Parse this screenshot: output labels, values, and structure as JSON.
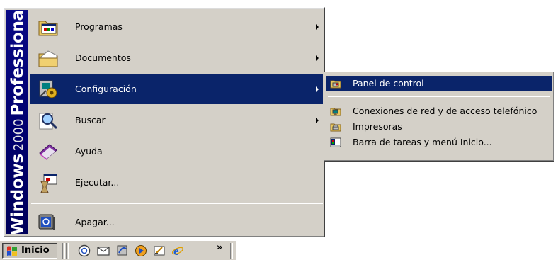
{
  "banner": {
    "part1": "Windows",
    "part2": "2000",
    "part3": "Professional"
  },
  "start_menu": {
    "items": [
      {
        "label": "Programas",
        "icon": "programs-folder-icon"
      },
      {
        "label": "Documentos",
        "icon": "documents-folder-icon"
      },
      {
        "label": "Configuración",
        "icon": "settings-icon"
      },
      {
        "label": "Buscar",
        "icon": "search-icon"
      },
      {
        "label": "Ayuda",
        "icon": "help-book-icon"
      },
      {
        "label": "Ejecutar...",
        "icon": "run-icon"
      },
      {
        "label": "Apagar...",
        "icon": "shutdown-icon"
      }
    ]
  },
  "submenu": {
    "items": [
      {
        "label": "Panel de control",
        "icon": "control-panel-icon"
      },
      {
        "label": "Conexiones de red y de acceso telefónico",
        "icon": "network-connections-icon"
      },
      {
        "label": "Impresoras",
        "icon": "printers-icon"
      },
      {
        "label": "Barra de tareas y menú Inicio...",
        "icon": "taskbar-start-menu-icon"
      }
    ]
  },
  "taskbar": {
    "start_label": "Inicio",
    "chevron": "»",
    "quick_launch": [
      "outlook-express-icon",
      "mail-icon",
      "channel-icon",
      "media-player-icon",
      "desktop-icon",
      "internet-explorer-icon"
    ]
  },
  "colors": {
    "menu_bg": "#d4d0c8",
    "highlight": "#0a246a",
    "banner": "#00006e"
  }
}
